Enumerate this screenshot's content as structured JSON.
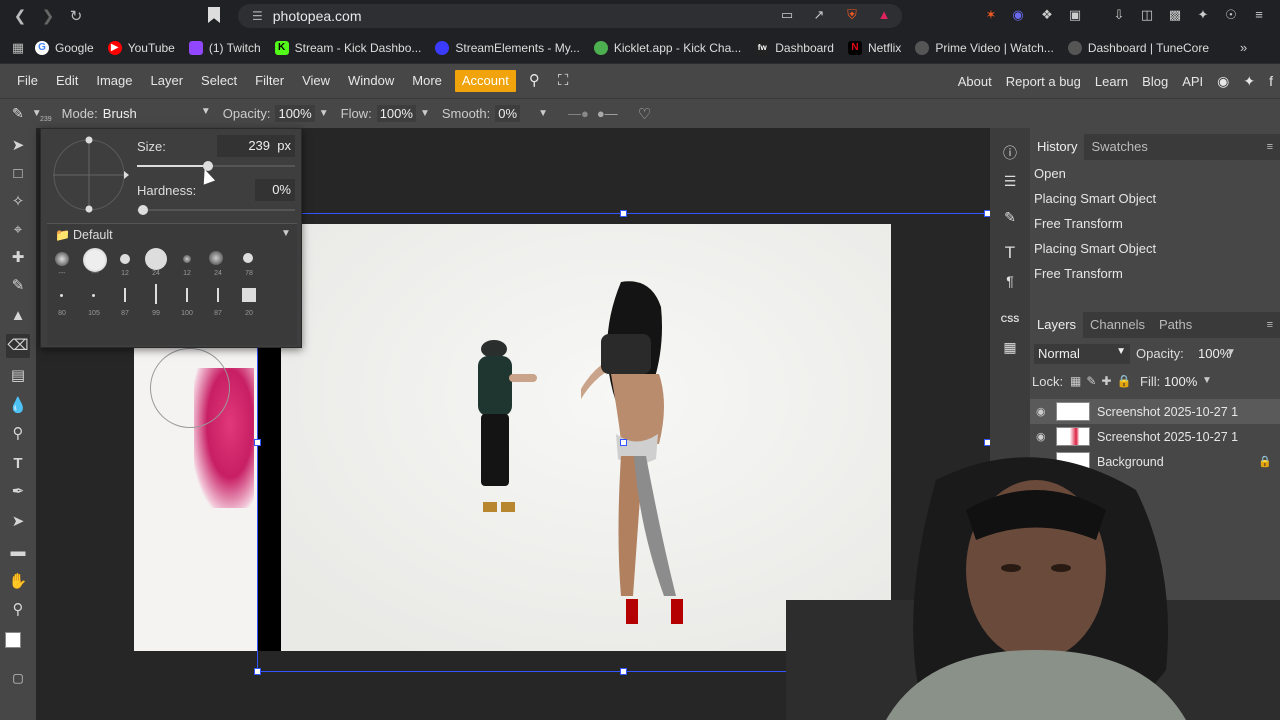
{
  "browser": {
    "url": "photopea.com",
    "bookmarks": [
      {
        "label": "Google",
        "color": "#ffffff"
      },
      {
        "label": "YouTube",
        "color": "#ff0000"
      },
      {
        "label": "(1) Twitch",
        "color": "#9146ff"
      },
      {
        "label": "Stream - Kick Dashbo...",
        "color": "#53fc18"
      },
      {
        "label": "StreamElements - My...",
        "color": "#3b3bff"
      },
      {
        "label": "Kicklet.app - Kick Cha...",
        "color": "#4caf50"
      },
      {
        "label": "Dashboard",
        "color": "#444444"
      },
      {
        "label": "Netflix",
        "color": "#e50914"
      },
      {
        "label": "Prime Video | Watch...",
        "color": "#cccccc"
      },
      {
        "label": "Dashboard | TuneCore",
        "color": "#cccccc"
      }
    ]
  },
  "menubar": {
    "items": [
      "File",
      "Edit",
      "Image",
      "Layer",
      "Select",
      "Filter",
      "View",
      "Window",
      "More"
    ],
    "account": "Account",
    "right": [
      "About",
      "Report a bug",
      "Learn",
      "Blog",
      "API"
    ]
  },
  "options": {
    "mode_label": "Mode:",
    "mode_value": "Brush",
    "opacity_label": "Opacity:",
    "opacity_value": "100%",
    "flow_label": "Flow:",
    "flow_value": "100%",
    "smooth_label": "Smooth:",
    "smooth_value": "0%",
    "brush_size_badge": "239"
  },
  "brush_popup": {
    "size_label": "Size:",
    "size_value": "239",
    "size_unit": "px",
    "size_fraction": 0.45,
    "hardness_label": "Hardness:",
    "hardness_value": "0%",
    "hardness_fraction": 0.0,
    "preset_group": "Default",
    "preset_sizes_row1": [
      "---",
      "---",
      "12",
      "24",
      "12",
      "24",
      "78"
    ],
    "preset_sizes_row2": [
      "80",
      "105",
      "87",
      "99",
      "100",
      "87",
      "20"
    ]
  },
  "history": {
    "tabs": [
      "History",
      "Swatches"
    ],
    "items": [
      "Open",
      "Placing Smart Object",
      "Free Transform",
      "Placing Smart Object",
      "Free Transform"
    ]
  },
  "layers": {
    "tabs": [
      "Layers",
      "Channels",
      "Paths"
    ],
    "blend_mode": "Normal",
    "opacity_label": "Opacity:",
    "opacity_value": "100%",
    "lock_label": "Lock:",
    "fill_label": "Fill:",
    "fill_value": "100%",
    "items": [
      "Screenshot 2025-10-27 1",
      "Screenshot 2025-10-27 1",
      "Background"
    ]
  },
  "colors": {
    "accent": "#f0a30a",
    "selection": "#3355ff",
    "panel": "#474747"
  }
}
